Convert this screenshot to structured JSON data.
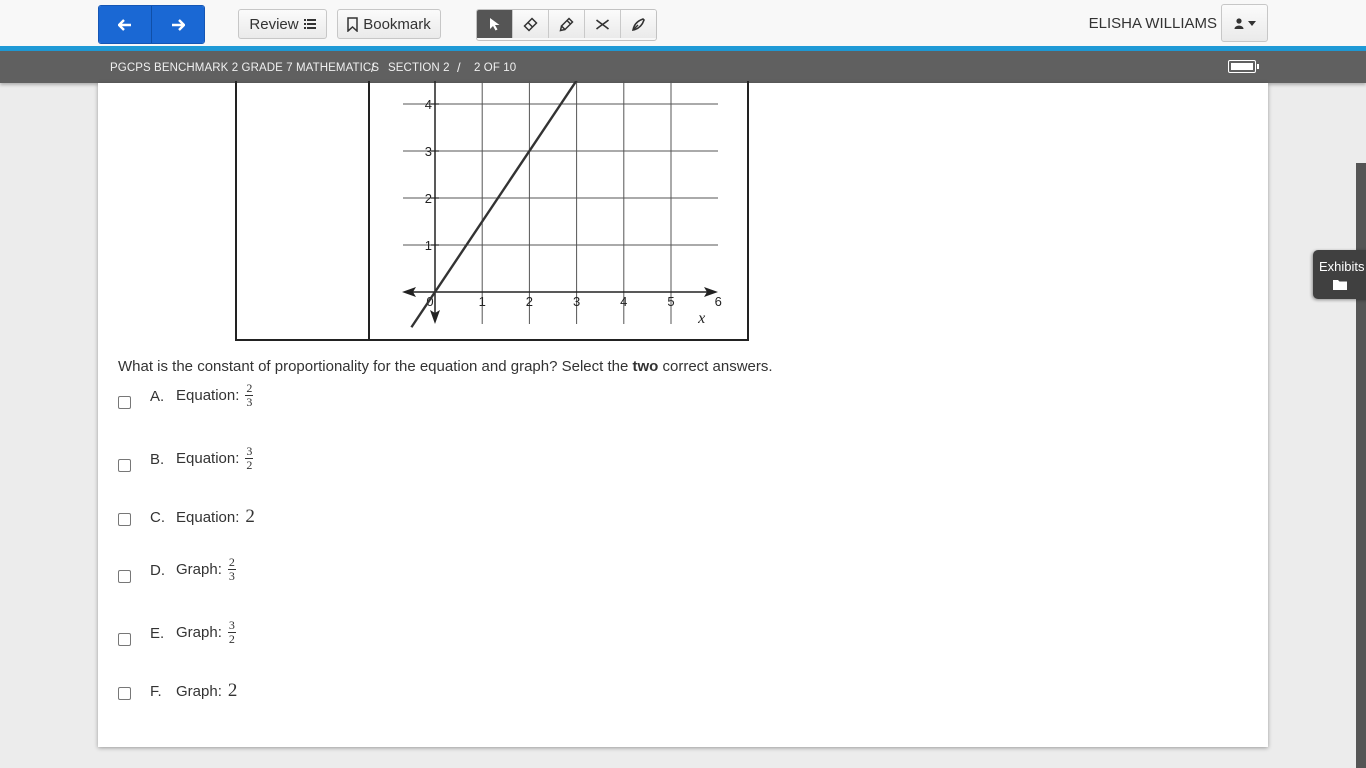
{
  "toolbar": {
    "review_label": "Review",
    "bookmark_label": "Bookmark",
    "user_name": "ELISHA WILLIAMS",
    "active_tool": "pointer-icon",
    "tools": [
      "pointer-icon",
      "eraser-icon",
      "highlighter-icon",
      "strikethrough-icon",
      "pen-icon"
    ]
  },
  "breadcrumb": {
    "test": "PGCPS BENCHMARK 2 GRADE 7 MATHEMATICS",
    "section": "SECTION 2",
    "position": "2 OF 10",
    "separator": "/"
  },
  "graph": {
    "y_ticks": [
      "4",
      "3",
      "2",
      "1"
    ],
    "x_ticks": [
      "0",
      "1",
      "2",
      "3",
      "4",
      "5",
      "6"
    ],
    "x_axis_label": "x",
    "line_slope": 1.5,
    "line_points": [
      [
        0,
        0
      ],
      [
        3,
        4.5
      ]
    ]
  },
  "question": {
    "prefix": "What is the constant of proportionality for the equation and graph? Select the ",
    "emphasis": "two",
    "suffix": " correct answers."
  },
  "choices": [
    {
      "letter": "A.",
      "label": "Equation:",
      "num": "2",
      "den": "3",
      "whole": ""
    },
    {
      "letter": "B.",
      "label": "Equation:",
      "num": "3",
      "den": "2",
      "whole": ""
    },
    {
      "letter": "C.",
      "label": "Equation:",
      "num": "",
      "den": "",
      "whole": "2"
    },
    {
      "letter": "D.",
      "label": "Graph:",
      "num": "2",
      "den": "3",
      "whole": ""
    },
    {
      "letter": "E.",
      "label": "Graph:",
      "num": "3",
      "den": "2",
      "whole": ""
    },
    {
      "letter": "F.",
      "label": "Graph:",
      "num": "",
      "den": "",
      "whole": "2"
    }
  ],
  "exhibit": {
    "label": "Exhibits"
  },
  "colors": {
    "accent": "#1f9ad6",
    "nav_button": "#1a68d4",
    "breadcrumb_bg": "#606060"
  }
}
